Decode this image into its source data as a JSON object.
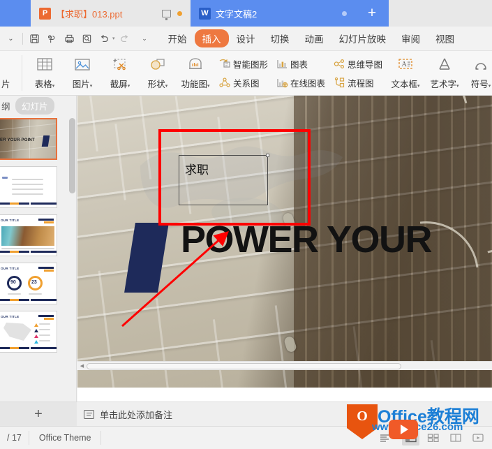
{
  "window": {
    "tabs": [
      {
        "icon": "powerpoint-icon",
        "icon_letter": "P",
        "title": "【求职】013.ppt",
        "active": false
      },
      {
        "icon": "word-icon",
        "icon_letter": "W",
        "title": "文字文稿2",
        "active": true
      }
    ],
    "new_tab_label": "+"
  },
  "quick_access": {
    "collapse_label": "⌄",
    "buttons": [
      "save-icon",
      "save-as-icon",
      "print-icon",
      "print-preview-icon",
      "undo-icon",
      "redo-icon",
      "customize-icon"
    ]
  },
  "ribbon_tabs": [
    {
      "label": "开始",
      "active": false
    },
    {
      "label": "插入",
      "active": true
    },
    {
      "label": "设计",
      "active": false
    },
    {
      "label": "切换",
      "active": false
    },
    {
      "label": "动画",
      "active": false
    },
    {
      "label": "幻灯片放映",
      "active": false
    },
    {
      "label": "审阅",
      "active": false
    },
    {
      "label": "视图",
      "active": false
    }
  ],
  "ribbon": {
    "clipped_left_label": "片",
    "big_buttons": [
      {
        "label": "表格",
        "icon": "table-icon",
        "has_caret": true
      },
      {
        "label": "图片",
        "icon": "picture-icon",
        "has_caret": true
      },
      {
        "label": "截屏",
        "icon": "screenshot-icon",
        "has_caret": true
      },
      {
        "label": "形状",
        "icon": "shapes-icon",
        "has_caret": true
      },
      {
        "label": "功能图",
        "icon": "function-chart-icon",
        "has_caret": true
      }
    ],
    "small_buttons": [
      {
        "label": "智能图形",
        "icon": "smartart-icon"
      },
      {
        "label": "关系图",
        "icon": "relationship-diagram-icon"
      },
      {
        "label": "图表",
        "icon": "chart-icon"
      },
      {
        "label": "在线图表",
        "icon": "online-chart-icon"
      },
      {
        "label": "思维导图",
        "icon": "mindmap-icon"
      },
      {
        "label": "流程图",
        "icon": "flowchart-icon"
      }
    ],
    "text_buttons": [
      {
        "label": "文本框",
        "icon": "textbox-icon",
        "has_caret": true
      },
      {
        "label": "艺术字",
        "icon": "wordart-icon",
        "has_caret": true
      },
      {
        "label": "符号",
        "icon": "symbol-icon",
        "has_caret": true
      }
    ]
  },
  "sidebar": {
    "tabs": [
      {
        "label": "纲",
        "active": false
      },
      {
        "label": "幻灯片",
        "active": true
      }
    ],
    "thumbnails": [
      {
        "index": 1,
        "selected": true,
        "kind": "title-brick",
        "text": "ER YOUR POINT"
      },
      {
        "index": 2,
        "selected": false,
        "kind": "bullet-list",
        "title": "",
        "lines": [
          "Add your Title in here.",
          "Add your Title in here.",
          "Add your Title in here.",
          "Add your Title in here."
        ]
      },
      {
        "index": 3,
        "selected": false,
        "kind": "image-title",
        "title": "OUR TITLE"
      },
      {
        "index": 4,
        "selected": false,
        "kind": "donut-stats",
        "title": "OUR TITLE",
        "values": [
          "90",
          "23"
        ]
      },
      {
        "index": 5,
        "selected": false,
        "kind": "map-legend",
        "title": "OUR TITLE"
      }
    ]
  },
  "slide": {
    "headline": "POWER YOUR",
    "textbox": {
      "value": "求职",
      "selected": true
    },
    "annotations": [
      {
        "type": "rectangle",
        "color": "#fe0000"
      },
      {
        "type": "arrow",
        "color": "#fe0000"
      }
    ]
  },
  "notes": {
    "add_slide_label": "+",
    "placeholder": "单击此处添加备注",
    "icon": "notes-icon"
  },
  "status": {
    "page_indicator": "/ 17",
    "theme": "Office Theme",
    "view_buttons": [
      "reading-layout-icon",
      "normal-view-icon",
      "slide-sorter-icon",
      "reading-view-icon",
      "slideshow-icon"
    ]
  },
  "watermark": {
    "logo_letter": "O",
    "title": "Office教程网",
    "url": "www.office26.com"
  },
  "colors": {
    "accent_orange": "#ee7840",
    "tab_blue": "#5b8def",
    "annotation_red": "#fe0000",
    "navy": "#1e2a5a",
    "watermark_blue": "#1c7fd6"
  }
}
